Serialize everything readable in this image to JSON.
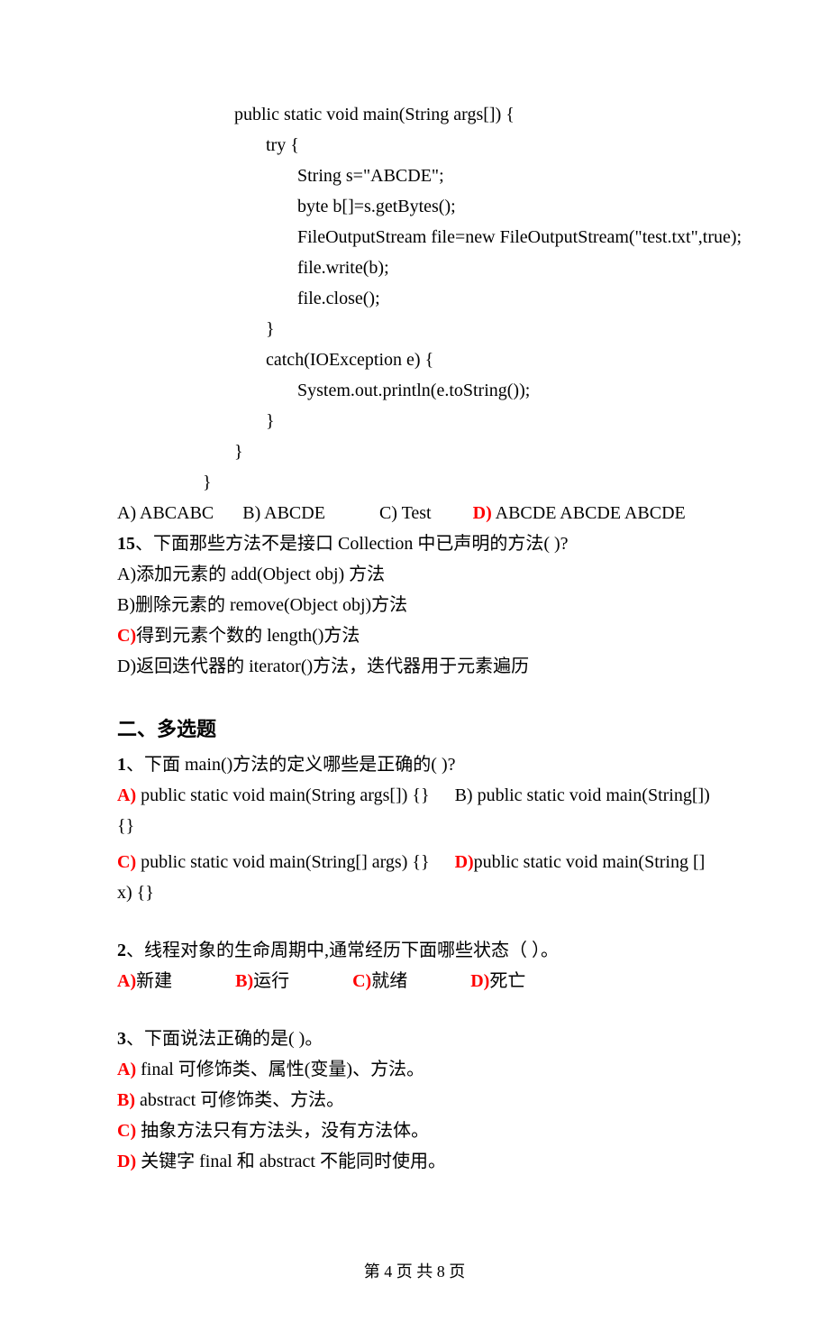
{
  "code": {
    "l1": "public static void main(String args[]) {",
    "l2": "try {",
    "l3": "String s=\"ABCDE\";",
    "l4": "byte b[]=s.getBytes();",
    "l5": "FileOutputStream file=new FileOutputStream(\"test.txt\",true);",
    "l6": "file.write(b);",
    "l7": "file.close();",
    "l8": "}",
    "l9": "catch(IOException e) {",
    "l10": "System.out.println(e.toString());",
    "l11": "}",
    "l12": "}",
    "l13": "}"
  },
  "q14opts": {
    "a": "A) ABCABC",
    "b": "B) ABCDE",
    "c": "C) Test",
    "d_prefix": "D)",
    "d_text": " ABCDE ABCDE ABCDE"
  },
  "q15": {
    "stem_prefix": "15",
    "stem": "、下面那些方法不是接口 Collection 中已声明的方法(    )?",
    "a": "A)添加元素的 add(Object   obj) 方法",
    "b": "B)删除元素的 remove(Object obj)方法",
    "c_prefix": "C)",
    "c_text": "得到元素个数的 length()方法",
    "d": "D)返回迭代器的 iterator()方法，迭代器用于元素遍历"
  },
  "section2": "二、多选题",
  "mq1": {
    "stem_prefix": "1",
    "stem": "、下面 main()方法的定义哪些是正确的(    )?",
    "a_prefix": "A)",
    "a_text": " public static void main(String args[]) {}",
    "b": "B) public static void main(String[]) {}",
    "c_prefix": "C)",
    "c_text": " public static void main(String[] args) {}",
    "d_prefix": "D)",
    "d_text": "public static void main(String [] x) {}"
  },
  "mq2": {
    "stem_prefix": "2",
    "stem": "、线程对象的生命周期中,通常经历下面哪些状态（       ）。",
    "a_prefix": "A)",
    "a_text": "新建",
    "b_prefix": "B)",
    "b_text": "运行",
    "c_prefix": "C)",
    "c_text": "就绪",
    "d_prefix": "D)",
    "d_text": "死亡"
  },
  "mq3": {
    "stem_prefix": "3",
    "stem": "、下面说法正确的是(      )。",
    "a_prefix": "A)",
    "a_text": " final 可修饰类、属性(变量)、方法。",
    "b_prefix": "B)",
    "b_text": " abstract 可修饰类、方法。",
    "c_prefix": "C)",
    "c_text": " 抽象方法只有方法头，没有方法体。",
    "d_prefix": "D)",
    "d_text": " 关键字 final 和 abstract 不能同时使用。"
  },
  "footer": "第 4 页 共 8 页"
}
